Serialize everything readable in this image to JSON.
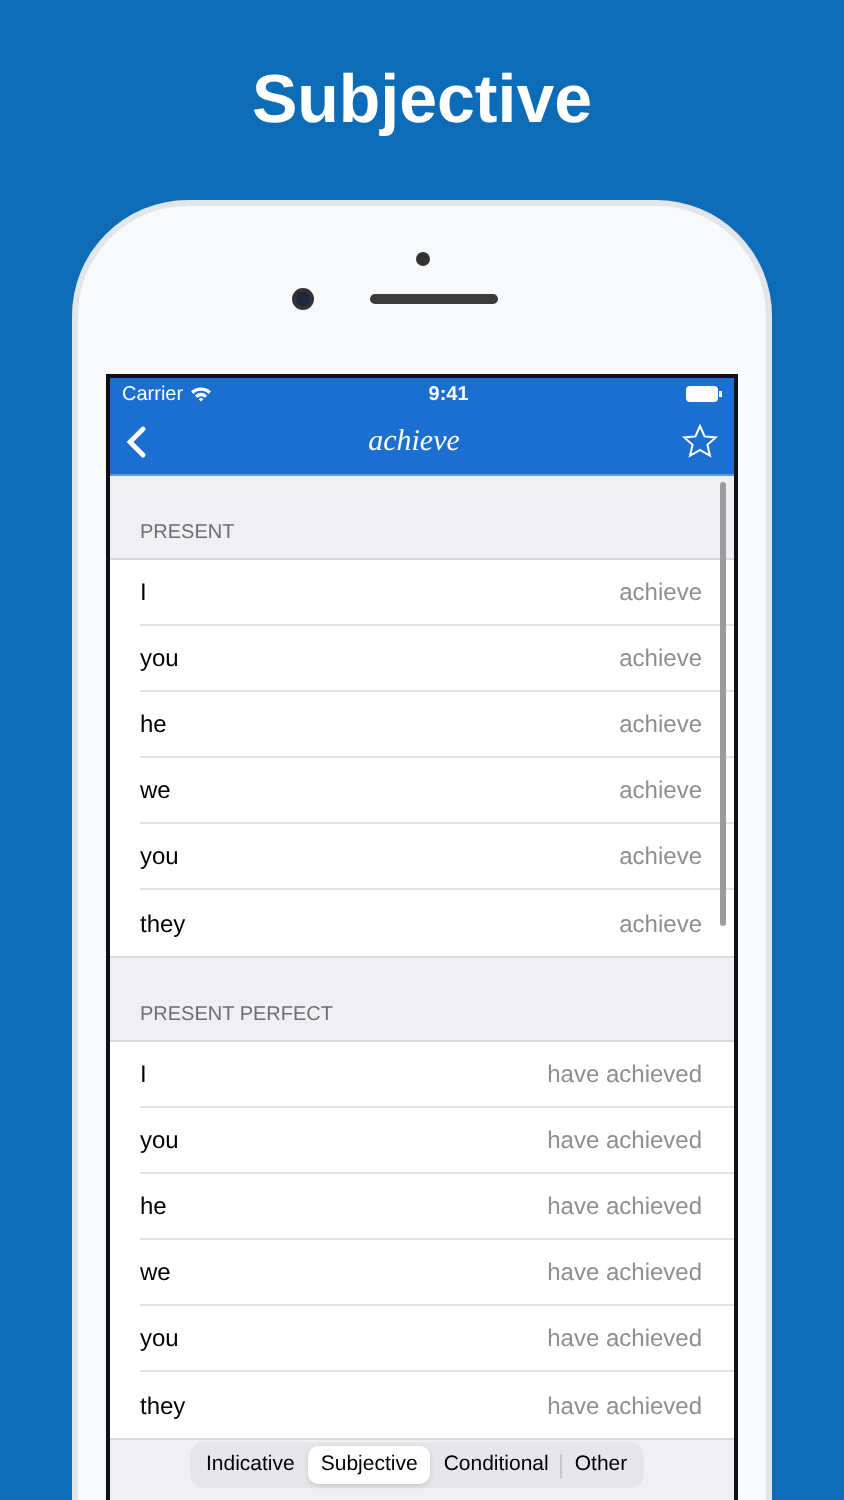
{
  "headline": "Subjective",
  "status_bar": {
    "carrier": "Carrier",
    "time": "9:41"
  },
  "nav_bar": {
    "title": "achieve"
  },
  "sections": [
    {
      "header": "PRESENT",
      "rows": [
        {
          "pronoun": "I",
          "form": "achieve"
        },
        {
          "pronoun": "you",
          "form": "achieve"
        },
        {
          "pronoun": "he",
          "form": "achieve"
        },
        {
          "pronoun": "we",
          "form": "achieve"
        },
        {
          "pronoun": "you",
          "form": "achieve"
        },
        {
          "pronoun": "they",
          "form": "achieve"
        }
      ]
    },
    {
      "header": "PRESENT PERFECT",
      "rows": [
        {
          "pronoun": "I",
          "form": "have achieved"
        },
        {
          "pronoun": "you",
          "form": "have achieved"
        },
        {
          "pronoun": "he",
          "form": "have achieved"
        },
        {
          "pronoun": "we",
          "form": "have achieved"
        },
        {
          "pronoun": "you",
          "form": "have achieved"
        },
        {
          "pronoun": "they",
          "form": "have achieved"
        }
      ]
    }
  ],
  "segments": [
    {
      "label": "Indicative",
      "selected": false
    },
    {
      "label": "Subjective",
      "selected": true
    },
    {
      "label": "Conditional",
      "selected": false
    },
    {
      "label": "Other",
      "selected": false
    }
  ]
}
